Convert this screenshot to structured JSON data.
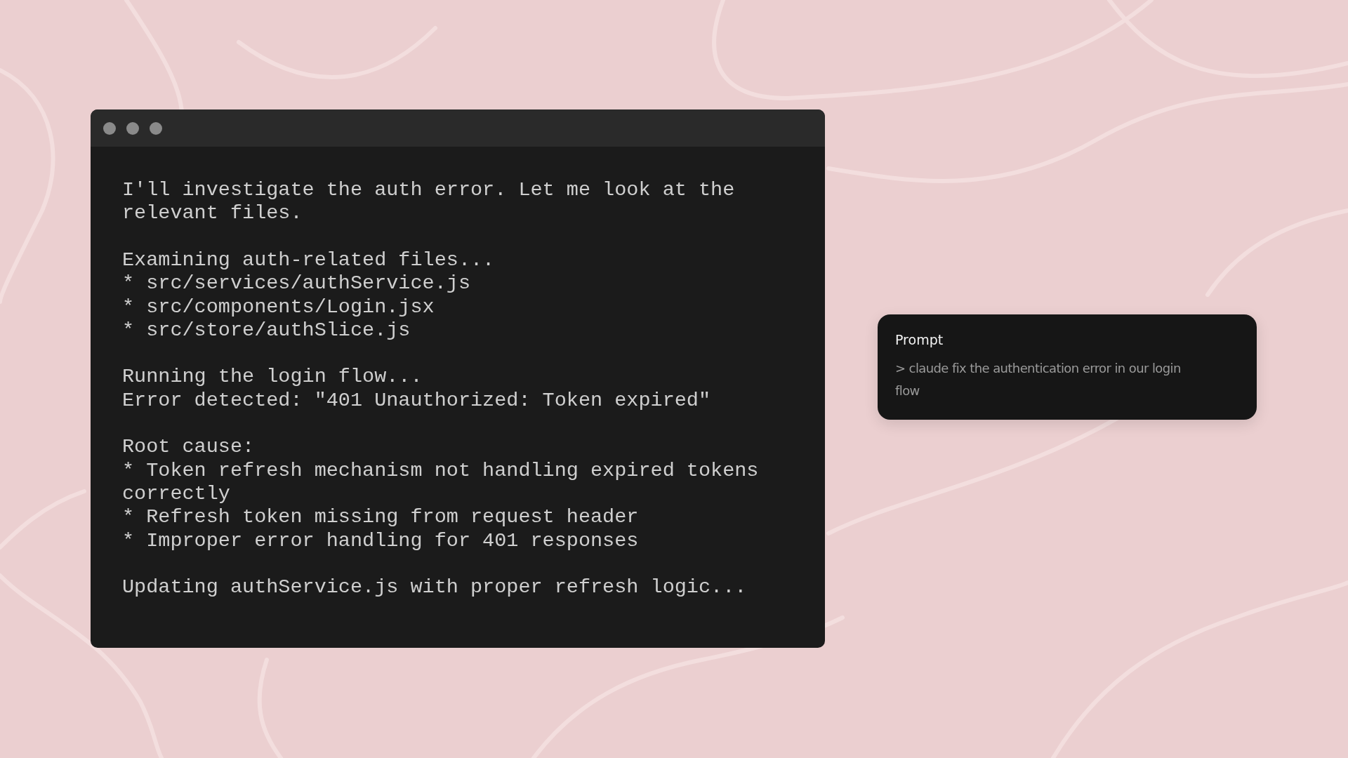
{
  "terminal": {
    "window_controls": [
      {
        "kind": "dot"
      },
      {
        "kind": "dot"
      },
      {
        "kind": "dot"
      }
    ],
    "blocks": [
      [
        "I'll investigate the auth error. Let me look at the relevant files."
      ],
      [
        "Examining auth-related files...",
        "* src/services/authService.js",
        "* src/components/Login.jsx",
        "* src/store/authSlice.js"
      ],
      [
        "Running the login flow...",
        "Error detected: \"401 Unauthorized: Token expired\""
      ],
      [
        "Root cause:",
        "* Token refresh mechanism not handling expired tokens correctly",
        "* Refresh token missing from request header",
        "* Improper error handling for 401 responses"
      ],
      [
        "Updating authService.js with proper refresh logic..."
      ]
    ]
  },
  "prompt_card": {
    "title": "Prompt",
    "text": "> claude fix the authentication error in our login flow"
  }
}
